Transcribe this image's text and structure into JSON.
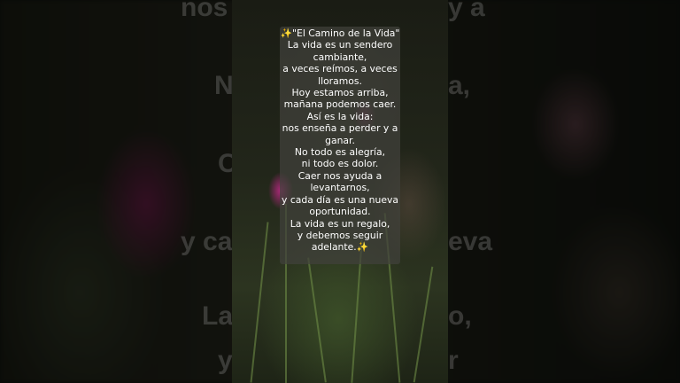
{
  "overlay": {
    "lines": [
      "✨\"El Camino de la Vida\"",
      "La vida es un sendero",
      "cambiante,",
      "a veces reímos, a veces",
      "lloramos.",
      "Hoy estamos arriba,",
      "mañana podemos caer.",
      "Así es la vida:",
      "nos enseña a perder y a",
      "ganar.",
      "No todo es alegría,",
      "ni todo es dolor.",
      "Caer nos ayuda a",
      "levantarnos,",
      "y cada día es una nueva",
      "oportunidad.",
      "La vida es un regalo,",
      "y debemos seguir",
      "adelante.✨"
    ]
  },
  "backdrop": {
    "ghost_text": [
      "nos",
      "y a",
      "N",
      "a,",
      "C",
      "y ca",
      "eva",
      "La",
      "o,",
      "y",
      "r"
    ]
  },
  "colors": {
    "overlay_bg": "#41413c",
    "text": "#ffffff",
    "flower": "#c8288c"
  }
}
